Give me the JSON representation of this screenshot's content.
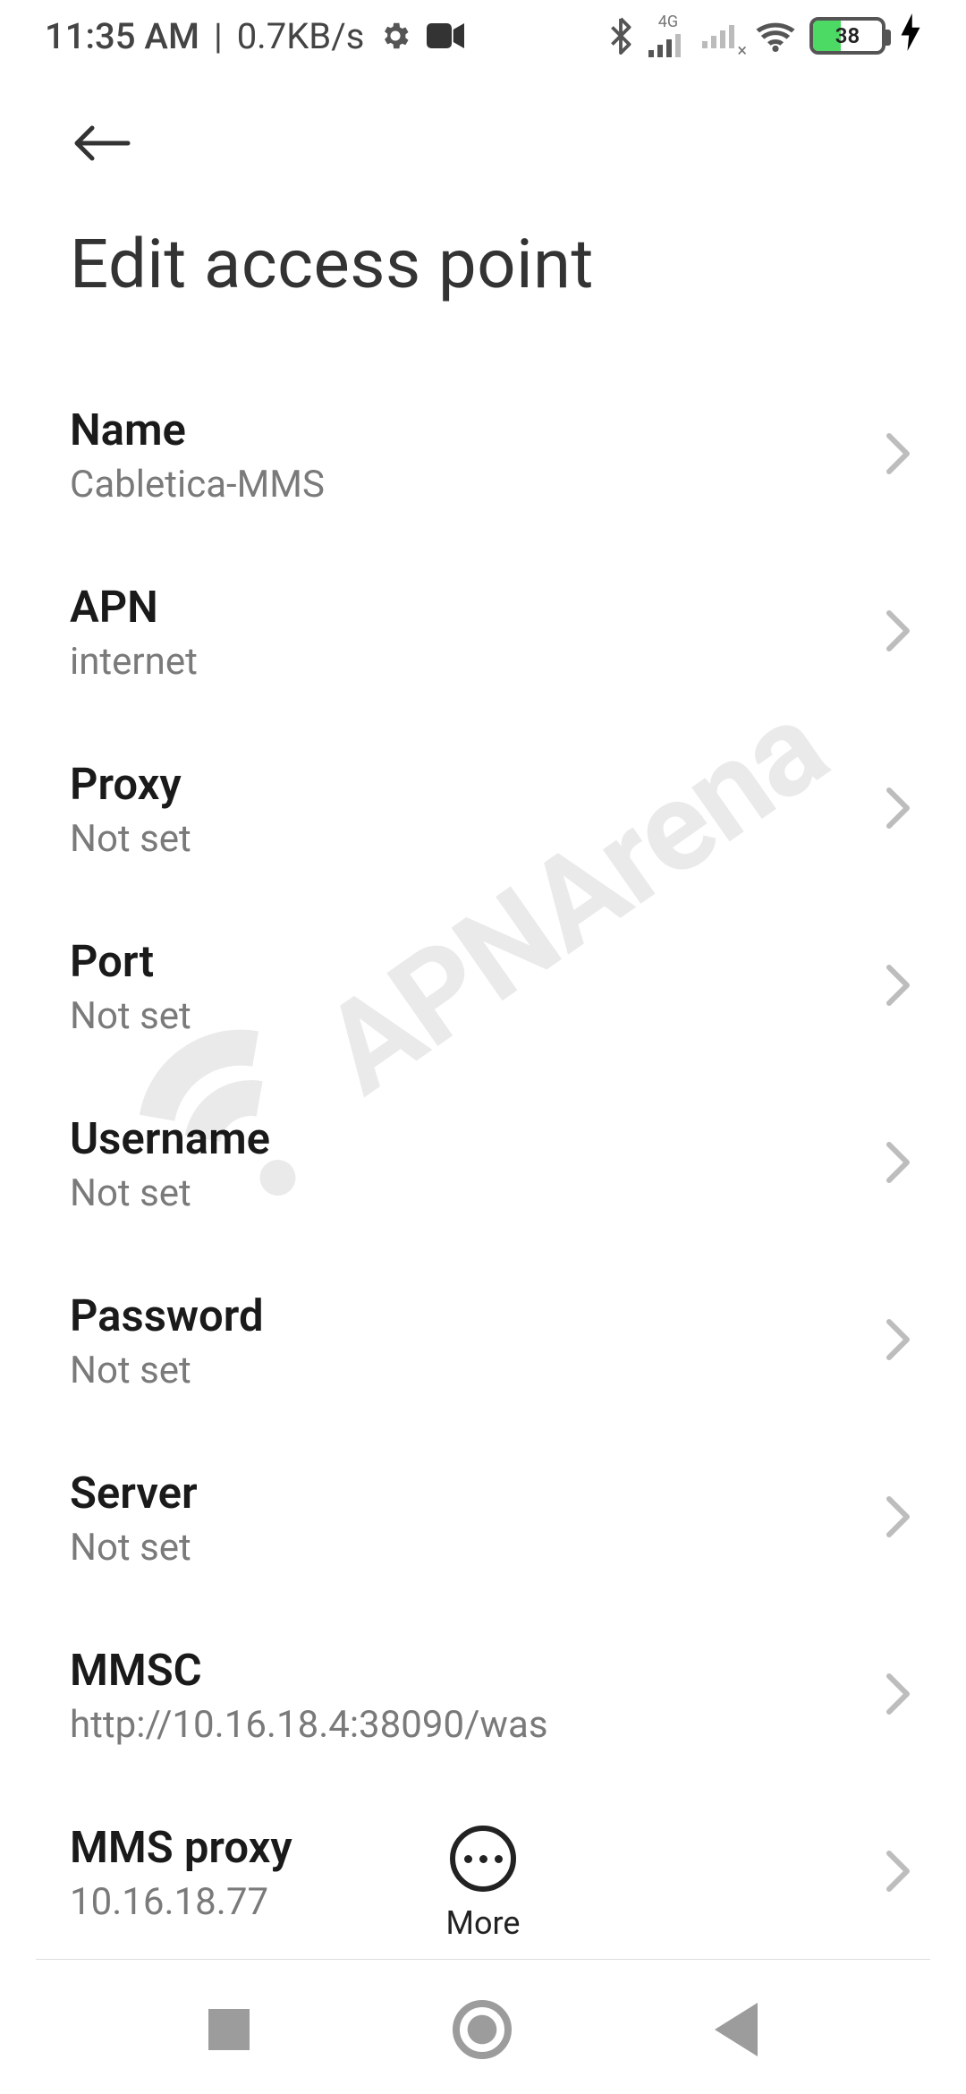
{
  "status_bar": {
    "time": "11:35 AM",
    "separator": "|",
    "data_rate": "0.7KB/s",
    "network_label": "4G",
    "battery_percent": "38"
  },
  "watermark": "APNArena",
  "header": {
    "page_title": "Edit access point"
  },
  "settings": [
    {
      "label": "Name",
      "value": "Cabletica-MMS"
    },
    {
      "label": "APN",
      "value": "internet"
    },
    {
      "label": "Proxy",
      "value": "Not set"
    },
    {
      "label": "Port",
      "value": "Not set"
    },
    {
      "label": "Username",
      "value": "Not set"
    },
    {
      "label": "Password",
      "value": "Not set"
    },
    {
      "label": "Server",
      "value": "Not set"
    },
    {
      "label": "MMSC",
      "value": "http://10.16.18.4:38090/was"
    },
    {
      "label": "MMS proxy",
      "value": "10.16.18.77"
    }
  ],
  "footer": {
    "more_label": "More"
  }
}
